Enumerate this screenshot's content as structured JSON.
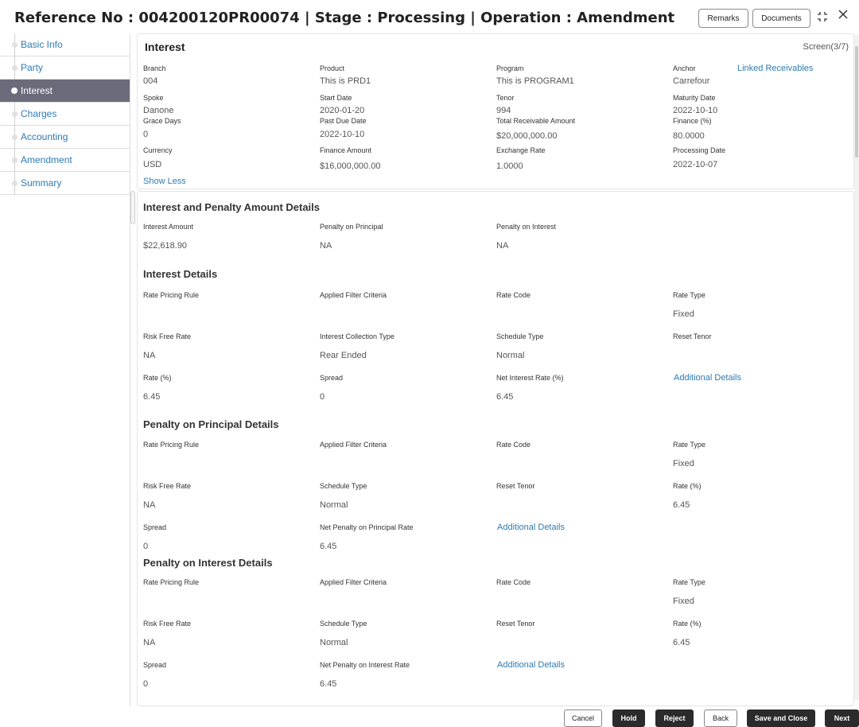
{
  "header": {
    "title": "Reference No : 004200120PR00074 | Stage : Processing | Operation : Amendment",
    "remarks_label": "Remarks",
    "documents_label": "Documents",
    "resize_icon": "expand-icon",
    "close_icon": "close-icon"
  },
  "sidebar": {
    "items": [
      {
        "label": "Basic Info"
      },
      {
        "label": "Party"
      },
      {
        "label": "Interest"
      },
      {
        "label": "Charges"
      },
      {
        "label": "Accounting"
      },
      {
        "label": "Amendment"
      },
      {
        "label": "Summary"
      }
    ]
  },
  "summary": {
    "title": "Interest",
    "screen": "Screen(3/7)",
    "linked_receivables": "Linked Receivables",
    "show_less": "Show Less",
    "fields": {
      "branch": {
        "label": "Branch",
        "value": "004"
      },
      "product": {
        "label": "Product",
        "value": "This is PRD1"
      },
      "program": {
        "label": "Program",
        "value": "This is PROGRAM1"
      },
      "anchor": {
        "label": "Anchor",
        "value": "Carrefour"
      },
      "spoke": {
        "label": "Spoke",
        "value": "Danone"
      },
      "start_date": {
        "label": "Start Date",
        "value": "2020-01-20"
      },
      "tenor": {
        "label": "Tenor",
        "value": "994"
      },
      "maturity_date": {
        "label": "Maturity Date",
        "value": "2022-10-10"
      },
      "grace_days": {
        "label": "Grace Days",
        "value": "0"
      },
      "past_due_date": {
        "label": "Past Due Date",
        "value": "2022-10-10"
      },
      "total_receivable": {
        "label": "Total Receivable Amount",
        "value": "$20,000,000.00"
      },
      "finance_pct": {
        "label": "Finance (%)",
        "value": "80.0000"
      },
      "currency": {
        "label": "Currency",
        "value": "USD"
      },
      "finance_amount": {
        "label": "Finance Amount",
        "value": "$16,000,000.00"
      },
      "exchange_rate": {
        "label": "Exchange Rate",
        "value": "1.0000"
      },
      "processing_date": {
        "label": "Processing Date",
        "value": "2022-10-07"
      }
    }
  },
  "amounts": {
    "title": "Interest and Penalty Amount Details",
    "interest_amount": {
      "label": "Interest Amount",
      "value": "$22,618.90"
    },
    "penalty_principal": {
      "label": "Penalty on Principal",
      "value": "NA"
    },
    "penalty_interest": {
      "label": "Penalty on Interest",
      "value": "NA"
    }
  },
  "interest_details": {
    "title": "Interest Details",
    "rate_pricing_rule": {
      "label": "Rate Pricing Rule",
      "value": ""
    },
    "applied_filter": {
      "label": "Applied Filter Criteria",
      "value": ""
    },
    "rate_code": {
      "label": "Rate Code",
      "value": ""
    },
    "rate_type": {
      "label": "Rate Type",
      "value": "Fixed"
    },
    "risk_free_rate": {
      "label": "Risk Free Rate",
      "value": "NA"
    },
    "collection_type": {
      "label": "Interest Collection Type",
      "value": "Rear Ended"
    },
    "schedule_type": {
      "label": "Schedule Type",
      "value": "Normal"
    },
    "reset_tenor": {
      "label": "Reset Tenor",
      "value": ""
    },
    "rate": {
      "label": "Rate (%)",
      "value": "6.45"
    },
    "spread": {
      "label": "Spread",
      "value": "0"
    },
    "net_rate": {
      "label": "Net Interest Rate (%)",
      "value": "6.45"
    },
    "additional": "Additional Details"
  },
  "penalty_principal_details": {
    "title": "Penalty on Principal Details",
    "rate_pricing_rule": {
      "label": "Rate Pricing Rule",
      "value": ""
    },
    "applied_filter": {
      "label": "Applied Filter Criteria",
      "value": ""
    },
    "rate_code": {
      "label": "Rate Code",
      "value": ""
    },
    "rate_type": {
      "label": "Rate Type",
      "value": "Fixed"
    },
    "risk_free_rate": {
      "label": "Risk Free Rate",
      "value": "NA"
    },
    "schedule_type": {
      "label": "Schedule Type",
      "value": "Normal"
    },
    "reset_tenor": {
      "label": "Reset Tenor",
      "value": ""
    },
    "rate": {
      "label": "Rate (%)",
      "value": "6.45"
    },
    "spread": {
      "label": "Spread",
      "value": "0"
    },
    "net_rate": {
      "label": "Net Penalty on Principal Rate",
      "value": "6.45"
    },
    "additional": "Additional Details"
  },
  "penalty_interest_details": {
    "title": "Penalty on Interest Details",
    "rate_pricing_rule": {
      "label": "Rate Pricing Rule",
      "value": ""
    },
    "applied_filter": {
      "label": "Applied Filter Criteria",
      "value": ""
    },
    "rate_code": {
      "label": "Rate Code",
      "value": ""
    },
    "rate_type": {
      "label": "Rate Type",
      "value": "Fixed"
    },
    "risk_free_rate": {
      "label": "Risk Free Rate",
      "value": "NA"
    },
    "schedule_type": {
      "label": "Schedule Type",
      "value": "Normal"
    },
    "reset_tenor": {
      "label": "Reset Tenor",
      "value": ""
    },
    "rate": {
      "label": "Rate (%)",
      "value": "6.45"
    },
    "spread": {
      "label": "Spread",
      "value": "0"
    },
    "net_rate": {
      "label": "Net Penalty on Interest Rate",
      "value": "6.45"
    },
    "additional": "Additional Details"
  },
  "footer": {
    "cancel": "Cancel",
    "hold": "Hold",
    "reject": "Reject",
    "back": "Back",
    "save_close": "Save and Close",
    "next": "Next"
  },
  "colors": {
    "accent_link": "#2e7bb2",
    "active_nav": "#6b6b7b",
    "dark_button": "#2b2b2b"
  }
}
